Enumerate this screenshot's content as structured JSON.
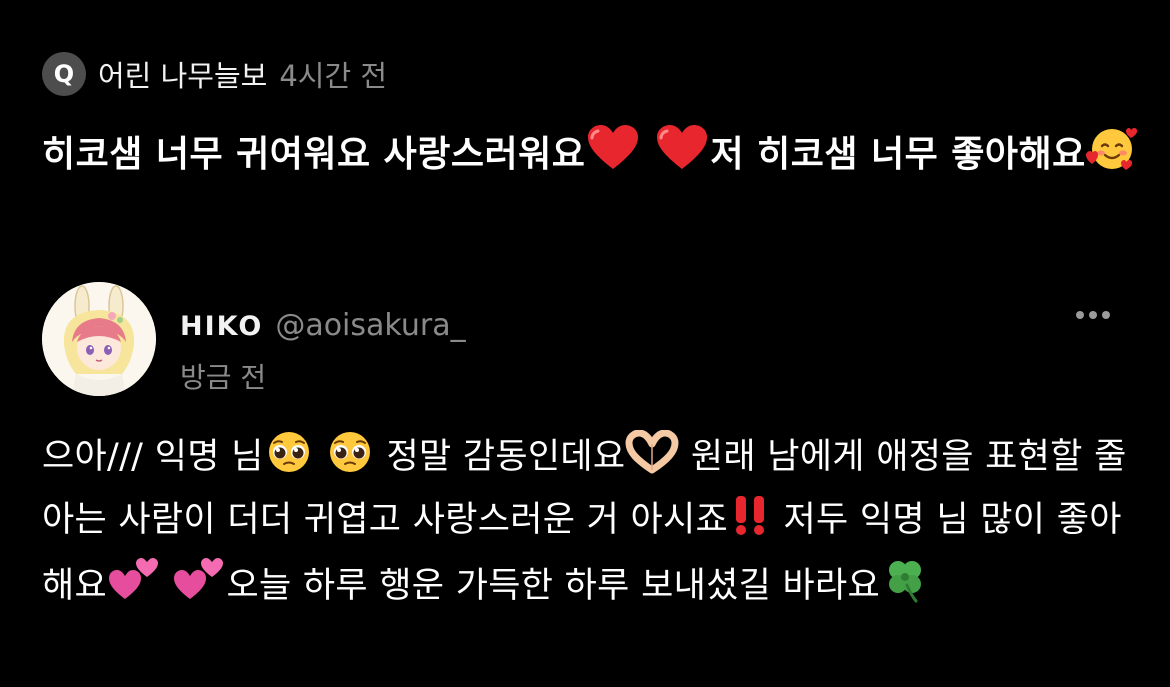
{
  "question": {
    "badge": "Q",
    "user": "어린 나무늘보",
    "time": "4시간 전",
    "text_1": "히코샘 너무 귀여워요 사랑스러워요",
    "text_2": "저 히코샘 너무 좋아해요"
  },
  "answer": {
    "name": "HIKO",
    "handle": "@aoisakura_",
    "time": "방금 전",
    "seg_1": "으아/// 익명 님",
    "seg_2": " 정말 감동인데요",
    "seg_3": " 원래 남에게 애정을 표현할 줄 아는 사람이 더더 귀엽고 사랑스러운 거 아시죠",
    "seg_4": " 저두 익명 님 많이 좋아해요",
    "seg_5": "오늘 하루 행운 가득한 하루 보내셨길 바라요"
  },
  "icons": {
    "heart": "red-heart-icon",
    "smiling_hearts": "smiling-face-with-hearts-icon",
    "pleading": "pleading-face-icon",
    "heart_hands": "heart-hands-icon",
    "double_exclamation": "double-exclamation-icon",
    "two_hearts": "two-hearts-icon",
    "clover": "four-leaf-clover-icon",
    "more": "more-options-icon"
  },
  "colors": {
    "background": "#000000",
    "text": "#ffffff",
    "muted": "#8a8a8a",
    "badge": "#4d4d4d"
  }
}
